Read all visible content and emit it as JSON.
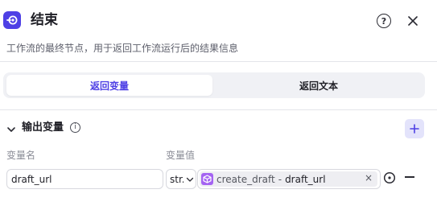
{
  "header": {
    "title": "结束",
    "icon": "end-node-icon",
    "help_label": "?",
    "description": "工作流的最终节点，用于返回工作流运行后的结果信息"
  },
  "tabs": [
    {
      "label": "返回变量",
      "active": true
    },
    {
      "label": "返回文本",
      "active": false
    }
  ],
  "output": {
    "section_title": "输出变量",
    "info_icon": "info-icon",
    "add_icon": "plus-icon",
    "col_name_label": "变量名",
    "col_value_label": "变量值",
    "rows": [
      {
        "name": "draft_url",
        "type": "str.",
        "ref_source": "create_draft",
        "ref_sep": "-",
        "ref_var": "draft_url",
        "clear_label": "×"
      }
    ]
  },
  "colors": {
    "accent": "#4e40e5",
    "chip_icon": "#a463f2",
    "add_button_bg": "#e3e3fb"
  }
}
